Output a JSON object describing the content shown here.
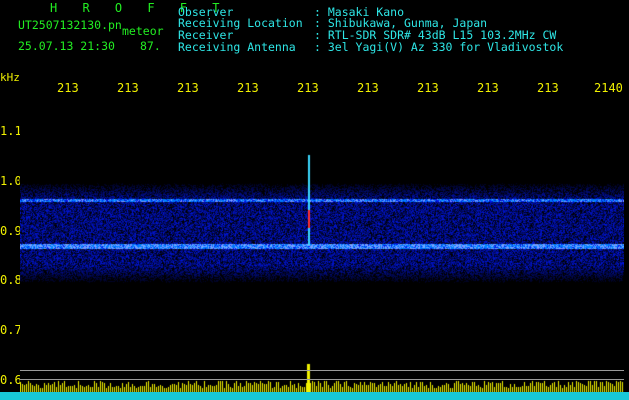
{
  "title": "H R O F F T",
  "file_name": "UT2507132130.pn",
  "meteor_label": "meteor",
  "datetime": "25.07.13 21:30",
  "meteor_count": "87.",
  "meta": [
    {
      "key": "Observer",
      "value": ": Masaki Kano"
    },
    {
      "key": "Receiving Location",
      "value": ": Shibukawa, Gunma, Japan"
    },
    {
      "key": "Receiver",
      "value": ": RTL-SDR SDR# 43dB L15 103.2MHz CW"
    },
    {
      "key": "Receiving Antenna",
      "value": ": 3el Yagi(V) Az 330 for Vladivostok"
    }
  ],
  "x_ticks": [
    "213",
    "213",
    "213",
    "213",
    "213",
    "213",
    "213",
    "213",
    "213",
    "2140"
  ],
  "y_unit": "kHz",
  "y_ticks": [
    "1.1",
    "1.0",
    "0.9",
    "0.8",
    "0.7",
    "0.6"
  ],
  "colors": {
    "text_green": "#22ee22",
    "text_cyan": "#2ee6e6",
    "axis_yellow": "#f0f000",
    "background": "#000000"
  }
}
